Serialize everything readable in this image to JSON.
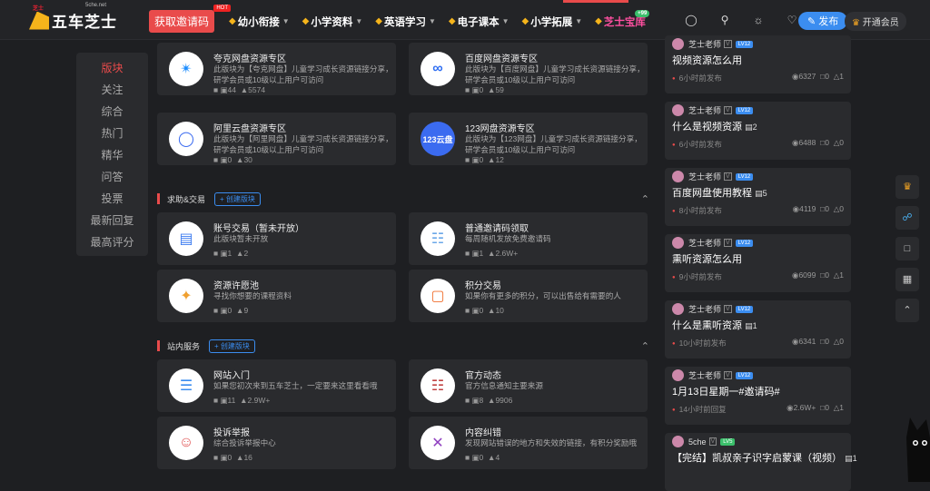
{
  "header": {
    "logo": "五车芝士",
    "logo_site": "5che.net",
    "logo_red": "芝士",
    "invite": "获取邀请码",
    "invite_badge": "HOT",
    "nav": [
      {
        "label": "幼小衔接",
        "caret": true
      },
      {
        "label": "小学资料",
        "caret": true
      },
      {
        "label": "英语学习",
        "caret": true
      },
      {
        "label": "电子课本",
        "caret": true
      },
      {
        "label": "小学拓展",
        "caret": true
      },
      {
        "label": "芝士宝库",
        "caret": false,
        "badge": "+99"
      }
    ],
    "post": "发布",
    "vip": "开通会员"
  },
  "sidebar": [
    "版块",
    "关注",
    "综合",
    "热门",
    "精华",
    "问答",
    "投票",
    "最新回复",
    "最高评分"
  ],
  "cards": [
    {
      "title": "夸克网盘资源专区",
      "desc": "此版块为【夸克网盘】儿童学习成长资源链接分享，研学会员或10级以上用户可访问",
      "posts": "44",
      "views": "5574",
      "icon": "quark"
    },
    {
      "title": "百度网盘资源专区",
      "desc": "此版块为【百度网盘】儿童学习成长资源链接分享，研学会员或10级以上用户可访问",
      "posts": "0",
      "views": "59",
      "icon": "baidu"
    },
    {
      "title": "阿里云盘资源专区",
      "desc": "此版块为【阿里网盘】儿童学习成长资源链接分享，研学会员或10级以上用户可访问",
      "posts": "0",
      "views": "30",
      "icon": "ali"
    },
    {
      "title": "123网盘资源专区",
      "desc": "此版块为【123网盘】儿童学习成长资源链接分享，研学会员或10级以上用户可访问",
      "posts": "0",
      "views": "12",
      "icon": "123云盘"
    },
    {
      "title": "账号交易（暂未开放）",
      "desc": "此版块暂未开放",
      "posts": "1",
      "views": "2",
      "icon": "account"
    },
    {
      "title": "普通邀请码领取",
      "desc": "每周随机发放免费邀请码",
      "posts": "1",
      "views": "2.6W+",
      "icon": "invite"
    },
    {
      "title": "资源许愿池",
      "desc": "寻找你想要的课程资料",
      "posts": "0",
      "views": "9",
      "icon": "wish"
    },
    {
      "title": "积分交易",
      "desc": "如果你有更多的积分，可以出售给有需要的人",
      "posts": "0",
      "views": "10",
      "icon": "points"
    },
    {
      "title": "网站入门",
      "desc": "如果您初次来到五车芝士，一定要来这里看看哦",
      "posts": "11",
      "views": "2.9W+",
      "icon": "guide"
    },
    {
      "title": "官方动态",
      "desc": "官方信息通知主要来源",
      "posts": "8",
      "views": "9906",
      "icon": "news"
    },
    {
      "title": "投诉举报",
      "desc": "综合投诉举报中心",
      "posts": "0",
      "views": "16",
      "icon": "report"
    },
    {
      "title": "内容纠错",
      "desc": "发现网站错误的地方和失效的链接，有积分奖励哦",
      "posts": "0",
      "views": "4",
      "icon": "fix"
    }
  ],
  "sections": [
    {
      "name": "求助&交易",
      "create": "+ 创建版块"
    },
    {
      "name": "站内服务",
      "create": "+ 创建版块"
    }
  ],
  "posts": [
    {
      "user": "芝士老师",
      "lv": "LV12",
      "title": "视频资源怎么用",
      "img": "",
      "time": "6小时前发布",
      "views": "6327",
      "comments": "0",
      "likes": "1"
    },
    {
      "user": "芝士老师",
      "lv": "LV12",
      "title": "什么是视频资源",
      "img": "2",
      "time": "6小时前发布",
      "views": "6488",
      "comments": "0",
      "likes": "0"
    },
    {
      "user": "芝士老师",
      "lv": "LV12",
      "title": "百度网盘使用教程",
      "img": "5",
      "time": "8小时前发布",
      "views": "4119",
      "comments": "0",
      "likes": "0"
    },
    {
      "user": "芝士老师",
      "lv": "LV12",
      "title": "熏听资源怎么用",
      "img": "",
      "time": "9小时前发布",
      "views": "6099",
      "comments": "0",
      "likes": "1"
    },
    {
      "user": "芝士老师",
      "lv": "LV12",
      "title": "什么是熏听资源",
      "img": "1",
      "time": "10小时前发布",
      "views": "6341",
      "comments": "0",
      "likes": "0"
    },
    {
      "user": "芝士老师",
      "lv": "LV12",
      "title": "1月13日星期一#邀请码#",
      "img": "",
      "time": "14小时前回复",
      "views": "2.6W+",
      "comments": "0",
      "likes": "1"
    },
    {
      "user": "5che",
      "lv": "LV5",
      "title": "【完结】凯叔亲子识字启蒙课（视频）",
      "img": "1",
      "time": "",
      "views": "",
      "comments": "",
      "likes": ""
    }
  ]
}
